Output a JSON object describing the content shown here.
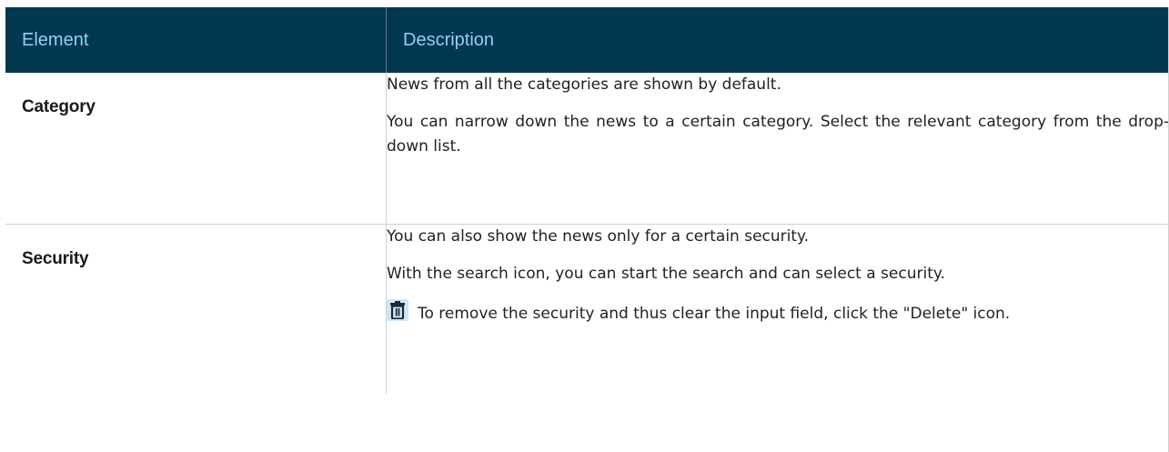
{
  "table": {
    "headers": {
      "element": "Element",
      "description": "Description"
    },
    "rows": [
      {
        "element": "Category",
        "paragraphs": [
          "News from all the categories are shown by default.",
          "You can narrow down the news to a certain category. Select the relevant category from the drop-down list."
        ]
      },
      {
        "element": "Security",
        "paragraphs": [
          "You can also show the news only for a certain security.",
          "With the search icon, you can start the search and can select a security."
        ],
        "icon_paragraph": {
          "icon": "trash-icon",
          "text": "To remove the security and thus clear the input field, click the \"Delete\" icon."
        }
      }
    ]
  },
  "colors": {
    "header_background": "#01374f",
    "header_text": "#8fd0f4",
    "icon_background": "#cfe6f8"
  }
}
